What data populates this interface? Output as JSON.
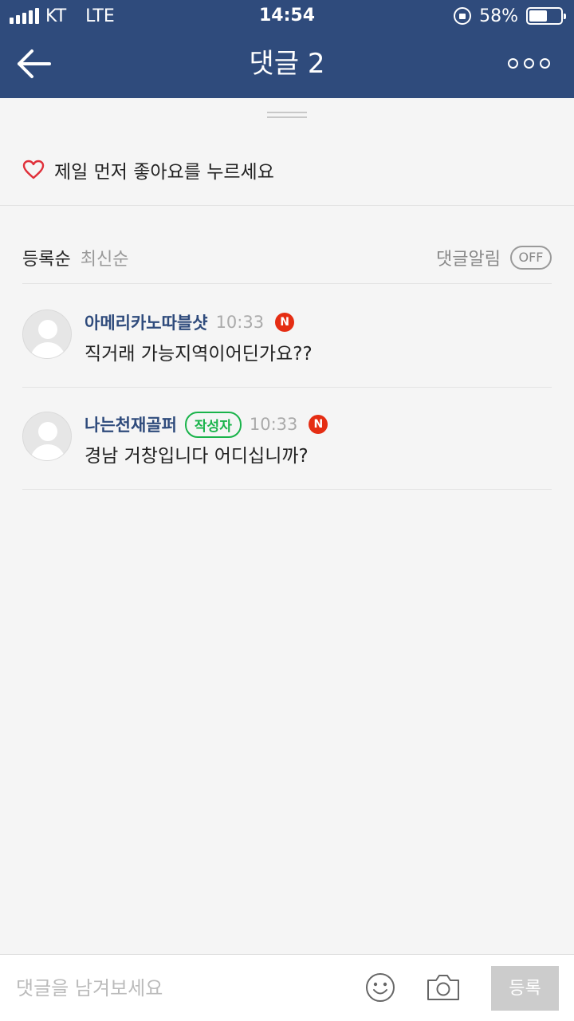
{
  "status_bar": {
    "carrier": "KT",
    "network": "LTE",
    "time": "14:54",
    "battery_percent": "58%",
    "battery_level": 0.58
  },
  "nav": {
    "title": "댓글 2",
    "back_icon": "arrow-left-icon",
    "more_icon": "more-dots-icon"
  },
  "like_bar": {
    "icon": "heart-outline-icon",
    "text": "제일 먼저 좋아요를 누르세요"
  },
  "sort": {
    "options": [
      {
        "label": "등록순",
        "active": true
      },
      {
        "label": "최신순",
        "active": false
      }
    ],
    "notification_label": "댓글알림",
    "notification_toggle": "OFF"
  },
  "comments": [
    {
      "username": "아메리카노따블샷",
      "author_badge": "",
      "time": "10:33",
      "new_badge": "N",
      "text": "직거래 가능지역이어딘가요??"
    },
    {
      "username": "나는천재골퍼",
      "author_badge": "작성자",
      "time": "10:33",
      "new_badge": "N",
      "text": "경남 거창입니다 어디십니까?"
    }
  ],
  "input_bar": {
    "placeholder": "댓글을 남겨보세요",
    "emoji_icon": "smiley-icon",
    "camera_icon": "camera-icon",
    "submit_label": "등록"
  },
  "colors": {
    "header_bg": "#2f4b7c",
    "username": "#2f4b7c",
    "author_badge": "#19b34a",
    "new_badge": "#e52d13",
    "heart": "#e0303a"
  }
}
